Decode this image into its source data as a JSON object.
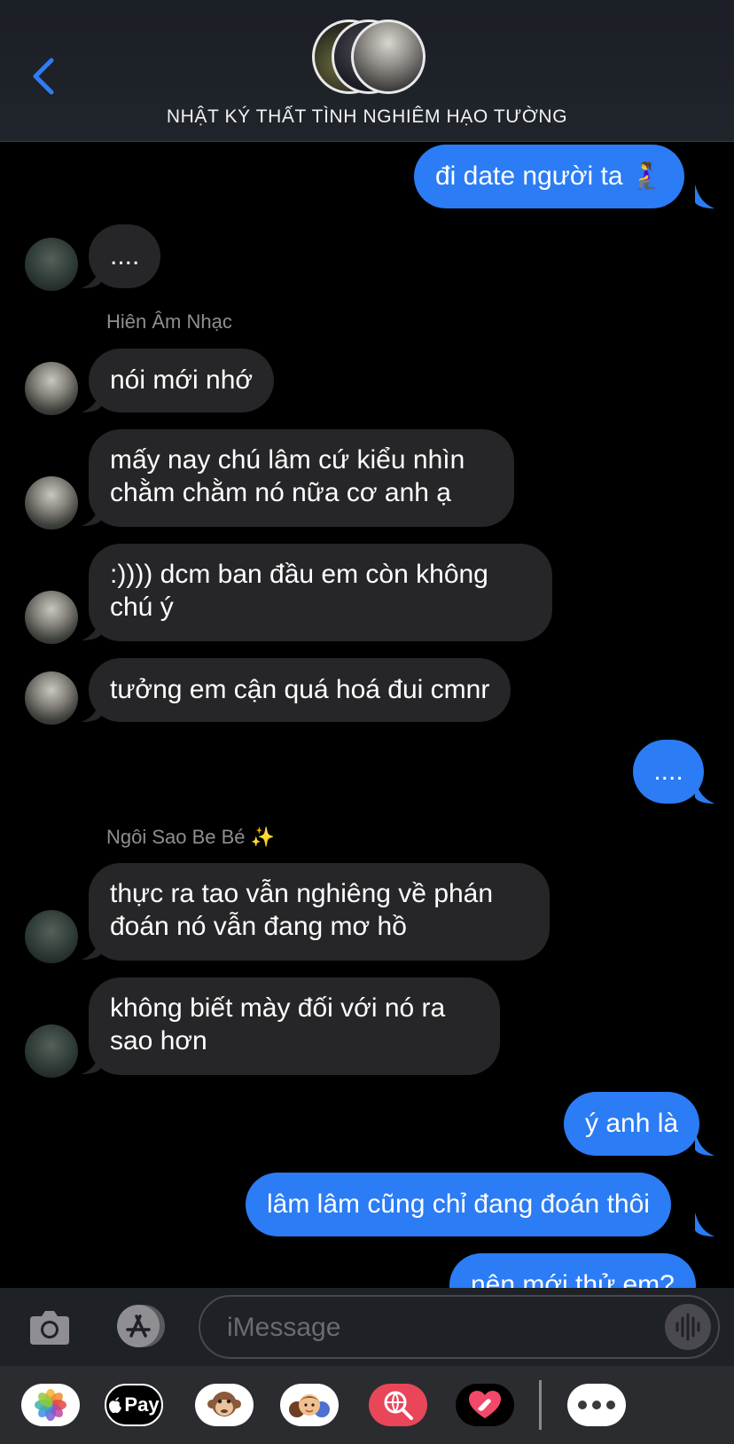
{
  "header": {
    "group_name": "NHẬT KÝ THẤT TÌNH NGHIÊM HẠO TƯỜNG",
    "back_icon": "chevron-left-icon"
  },
  "messages": [
    {
      "side": "out",
      "text": "đi date người ta 🧎‍♀️"
    },
    {
      "side": "in",
      "text": "...."
    },
    {
      "sender_label": "Hiên Âm Nhạc"
    },
    {
      "side": "in",
      "text": "nói mới nhớ"
    },
    {
      "side": "in",
      "lines": [
        "mấy nay chú lâm cứ kiểu nhìn",
        "chằm chằm nó nữa cơ anh ạ"
      ]
    },
    {
      "side": "in",
      "lines": [
        ":)))) dcm ban đầu em còn không",
        "chú ý"
      ]
    },
    {
      "side": "in",
      "text": "tưởng em cận quá hoá đui cmnr"
    },
    {
      "side": "out",
      "text": "...."
    },
    {
      "sender_label": "Ngôi Sao Be Bé ✨"
    },
    {
      "side": "in",
      "lines": [
        "thực ra tao vẫn nghiêng về phán",
        "đoán nó vẫn đang mơ hồ"
      ]
    },
    {
      "side": "in",
      "lines": [
        "không biết mày đối với nó ra",
        "sao hơn"
      ]
    },
    {
      "side": "out",
      "text": "ý anh là"
    },
    {
      "side": "out",
      "text": "lâm lâm cũng chỉ đang đoán thôi"
    },
    {
      "side": "out",
      "text": "nên mới thử em?"
    }
  ],
  "input": {
    "placeholder": "iMessage"
  },
  "apps": [
    "Photos",
    "Apple Pay",
    "Animoji",
    "Memoji",
    "Search Images",
    "Digital Touch",
    "More"
  ],
  "apple_pay_label": "Pay",
  "colors": {
    "outgoing_bubble": "#2b7cf5",
    "incoming_bubble": "#262628",
    "background": "#000000"
  }
}
